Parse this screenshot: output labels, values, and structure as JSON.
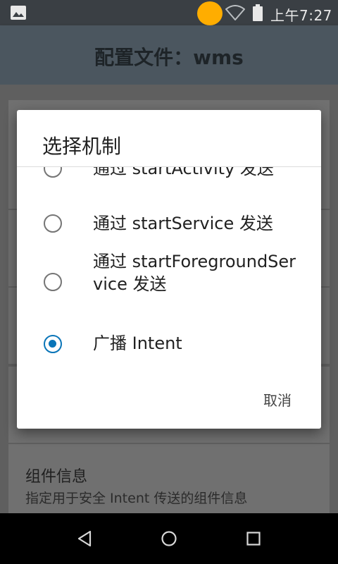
{
  "status_bar": {
    "time": "上午7:27",
    "icons": [
      "image-icon",
      "notification-dot",
      "wifi-icon",
      "battery-icon"
    ]
  },
  "app_bar": {
    "title": "配置文件：wms"
  },
  "background": {
    "card5": {
      "title": "组件信息",
      "subtitle": "指定用于安全 Intent 传送的组件信息"
    }
  },
  "dialog": {
    "title": "选择机制",
    "options": [
      {
        "label": "通过 startActivity 发送",
        "checked": false
      },
      {
        "label": "通过 startService 发送",
        "checked": false
      },
      {
        "label": "通过 startForegroundService 发送",
        "checked": false
      },
      {
        "label": "广播 Intent",
        "checked": true
      }
    ],
    "cancel_label": "取消"
  },
  "colors": {
    "accent": "#0a75b8",
    "notification_dot": "#ffad00"
  }
}
